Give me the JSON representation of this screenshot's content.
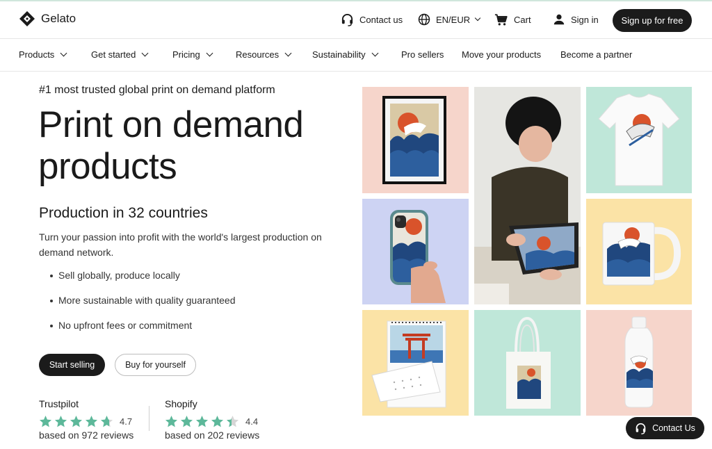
{
  "header": {
    "logo_text": "Gelato",
    "contact_label": "Contact us",
    "language_label": "EN/EUR",
    "cart_label": "Cart",
    "signin_label": "Sign in",
    "signup_label": "Sign up for free"
  },
  "nav": {
    "items": [
      {
        "label": "Products",
        "has_dropdown": true
      },
      {
        "label": "Get started",
        "has_dropdown": true
      },
      {
        "label": "Pricing",
        "has_dropdown": true
      },
      {
        "label": "Resources",
        "has_dropdown": true
      },
      {
        "label": "Sustainability",
        "has_dropdown": true
      },
      {
        "label": "Pro sellers",
        "has_dropdown": false
      },
      {
        "label": "Move your products",
        "has_dropdown": false
      },
      {
        "label": "Become a partner",
        "has_dropdown": false
      }
    ]
  },
  "hero": {
    "eyebrow": "#1 most trusted global print on demand platform",
    "title": "Print on demand products",
    "subhead": "Production in 32 countries",
    "description": "Turn your passion into profit with the world's largest production on demand network.",
    "bullets": [
      "Sell globally, produce locally",
      "More sustainable with quality guaranteed",
      "No upfront fees or commitment"
    ],
    "primary_cta": "Start selling",
    "secondary_cta": "Buy for yourself"
  },
  "ratings": [
    {
      "source": "Trustpilot",
      "score": "4.7",
      "reviews": "based on 972 reviews",
      "stars": 4.7
    },
    {
      "source": "Shopify",
      "score": "4.4",
      "reviews": "based on 202 reviews",
      "stars": 4.4
    }
  ],
  "product_tiles": [
    {
      "product": "framed-poster",
      "bg": "#f6d5cb"
    },
    {
      "product": "designer-photo",
      "bg": "#dfe2e0"
    },
    {
      "product": "t-shirt",
      "bg": "#bfe7d9"
    },
    {
      "product": "phone-case",
      "bg": "#cdd3f3"
    },
    {
      "product": "mug",
      "bg": "#fbe3a6"
    },
    {
      "product": "wall-calendar",
      "bg": "#fbe3a6"
    },
    {
      "product": "tote-bag",
      "bg": "#bfe7d9"
    },
    {
      "product": "water-bottle",
      "bg": "#f6d5cb"
    }
  ],
  "contact_fab_label": "Contact Us",
  "colors": {
    "dark": "#1b1b1b",
    "star_green": "#5db89a",
    "star_gray": "#d6d6d6"
  }
}
